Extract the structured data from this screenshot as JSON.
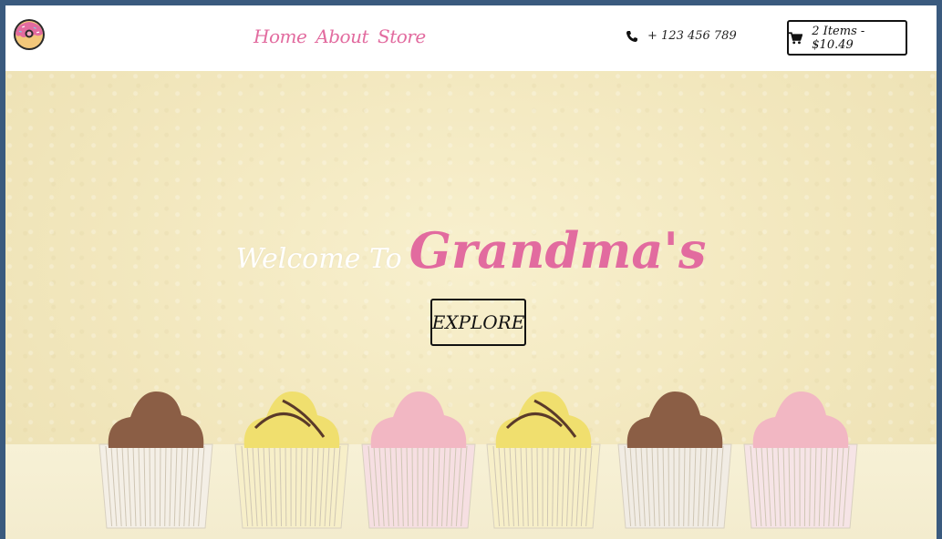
{
  "nav": {
    "links": [
      {
        "label": "Home"
      },
      {
        "label": "About"
      },
      {
        "label": "Store"
      }
    ],
    "phone": "+ 123 456 789",
    "cart": "2 Items - $10.49"
  },
  "hero": {
    "welcome_prefix": "Welcome To",
    "welcome_name": "Grandma's",
    "explore_label": "EXPLORE"
  },
  "colors": {
    "accent_pink": "#e26b9f",
    "background_cream": "#f5ecc2",
    "outer_frame": "#3a5a7e"
  },
  "icons": [
    "donut-logo-icon",
    "phone-icon",
    "cart-icon"
  ],
  "cupcakes": [
    {
      "topping": "chocolate",
      "top": "#8b5e45",
      "wrapper": "#f4efe6"
    },
    {
      "topping": "lemon",
      "top": "#f0df6e",
      "wrapper": "#f7efc9"
    },
    {
      "topping": "strawberry",
      "top": "#f2b7c3",
      "wrapper": "#f6dfe2"
    },
    {
      "topping": "lemon",
      "top": "#f0df6e",
      "wrapper": "#f7efc9"
    },
    {
      "topping": "chocolate",
      "top": "#8b5e45",
      "wrapper": "#f1ece4"
    },
    {
      "topping": "strawberry",
      "top": "#f2b7c3",
      "wrapper": "#f6e4e6"
    }
  ]
}
